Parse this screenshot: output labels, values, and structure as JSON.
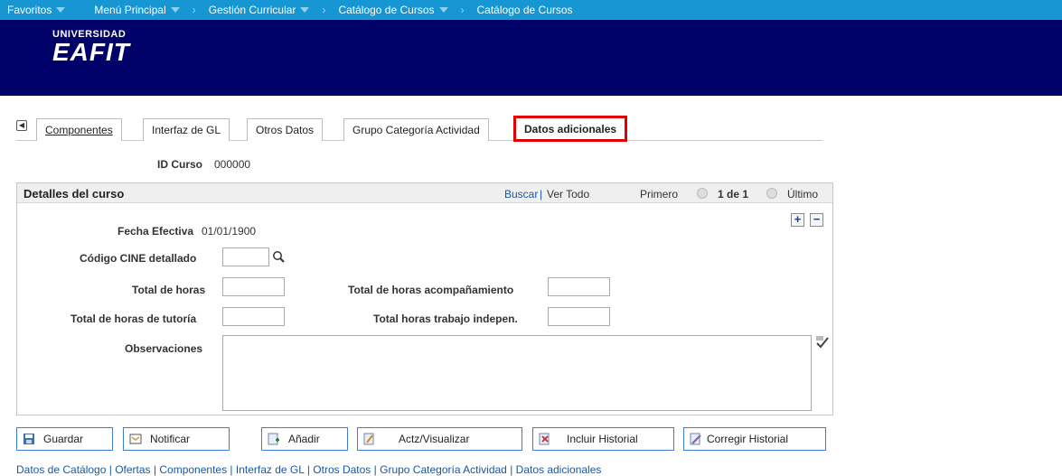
{
  "topnav": {
    "items": [
      "Favoritos",
      "Menú Principal",
      "Gestión Curricular",
      "Catálogo de Cursos",
      "Catálogo de Cursos"
    ]
  },
  "logo": {
    "line1": "UNIVERSIDAD",
    "line2": "EAFIT"
  },
  "tabs": [
    "Componentes",
    "Interfaz de GL",
    "Otros Datos",
    "Grupo Categoría Actividad",
    "Datos adicionales"
  ],
  "course": {
    "id_label": "ID Curso",
    "id_value": "000000"
  },
  "panel": {
    "title": "Detalles del curso",
    "search_link": "Buscar",
    "divider": "|",
    "view_all_link": "Ver Todo",
    "first_label": "Primero",
    "counter": "1 de 1",
    "last_label": "Último"
  },
  "form": {
    "effective_date_label": "Fecha Efectiva",
    "effective_date_value": "01/01/1900",
    "cine_label": "Código CINE detallado",
    "cine_value": "",
    "total_hours_label": "Total de horas",
    "total_hours_value": "",
    "accompaniment_label": "Total de horas acompañamiento",
    "accompaniment_value": "",
    "tutoring_label": "Total de horas de tutoría",
    "tutoring_value": "",
    "independent_label": "Total horas trabajo indepen.",
    "independent_value": "",
    "observations_label": "Observaciones",
    "observations_value": ""
  },
  "buttons": {
    "save": "Guardar",
    "notify": "Notificar",
    "add": "Añadir",
    "update": "Actz/Visualizar",
    "include_history": "Incluir Historial",
    "correct_history": "Corregir Historial"
  },
  "footer": {
    "links": [
      "Datos de Catálogo",
      "Ofertas",
      "Componentes",
      "Interfaz de GL",
      "Otros Datos",
      "Grupo Categoría Actividad",
      "Datos adicionales"
    ],
    "separator": " | "
  },
  "colors": {
    "nav_bar": "#1696d3",
    "banner": "#000069",
    "selected_tab_border": "#e00000",
    "link": "#1b57a6"
  }
}
